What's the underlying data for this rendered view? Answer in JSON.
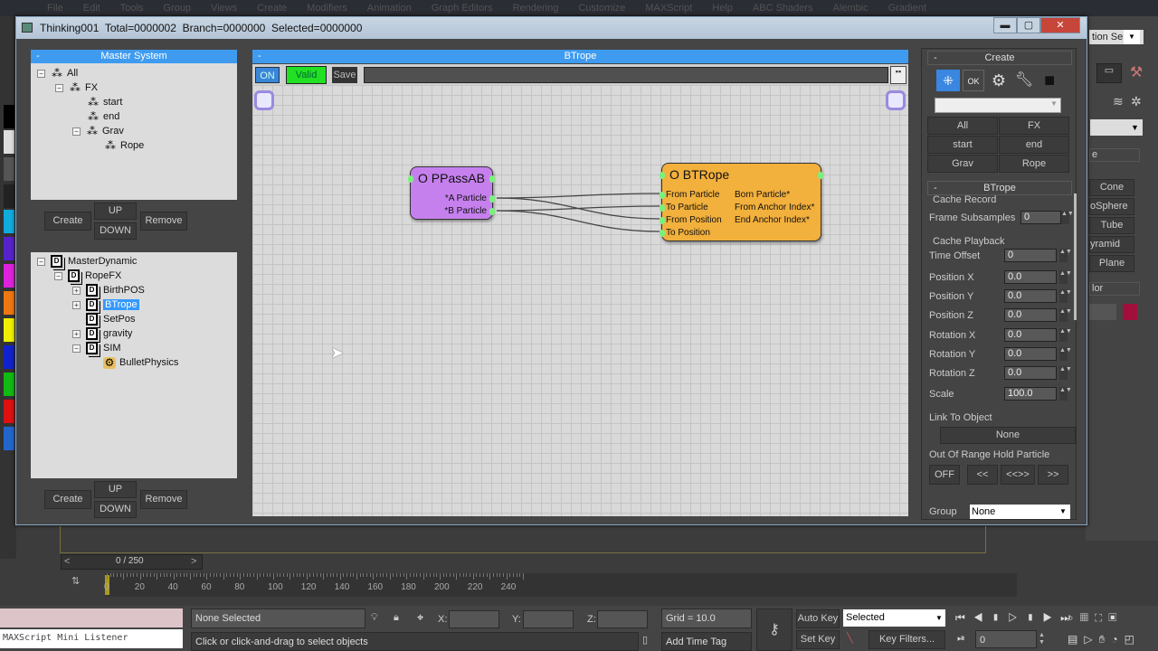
{
  "menubar": [
    "File",
    "Edit",
    "Tools",
    "Group",
    "Views",
    "Create",
    "Modifiers",
    "Animation",
    "Graph Editors",
    "Rendering",
    "Customize",
    "MAXScript",
    "Help",
    "ABC Shaders",
    "Alembic",
    "Gradient"
  ],
  "window": {
    "title": "Thinking001  Total=0000002  Branch=0000000  Selected=0000000"
  },
  "master_system": {
    "title": "Master System",
    "collapse": "-",
    "tree": [
      {
        "label": "All",
        "expanded": true,
        "depth": 0
      },
      {
        "label": "FX",
        "expanded": true,
        "depth": 1
      },
      {
        "label": "start",
        "depth": 2
      },
      {
        "label": "end",
        "depth": 2
      },
      {
        "label": "Grav",
        "expanded": true,
        "depth": 2
      },
      {
        "label": "Rope",
        "depth": 3
      }
    ],
    "buttons": {
      "create": "Create",
      "up": "UP",
      "down": "DOWN",
      "remove": "Remove"
    }
  },
  "dynamic_tree": {
    "tree": [
      {
        "label": "MasterDynamic",
        "depth": 0,
        "toggle": "−"
      },
      {
        "label": "RopeFX",
        "depth": 1,
        "toggle": "−"
      },
      {
        "label": "BirthPOS",
        "depth": 2,
        "toggle": "+"
      },
      {
        "label": "BTrope",
        "depth": 2,
        "toggle": "+",
        "selected": true
      },
      {
        "label": "SetPos",
        "depth": 2
      },
      {
        "label": "gravity",
        "depth": 2,
        "toggle": "+"
      },
      {
        "label": "SIM",
        "depth": 2,
        "toggle": "−"
      },
      {
        "label": "BulletPhysics",
        "depth": 3
      }
    ],
    "buttons": {
      "create": "Create",
      "up": "UP",
      "down": "DOWN",
      "remove": "Remove"
    }
  },
  "graph": {
    "title": "BTrope",
    "collapse": "-",
    "toolbar": {
      "on": "ON",
      "valid": "Valid",
      "save": "Save"
    },
    "nodes": {
      "ppass": {
        "title": "O PPassAB",
        "color": "#c680ee",
        "outputs": [
          "*A Particle",
          "*B Particle"
        ]
      },
      "btrope": {
        "title": "O BTRope",
        "color": "#f2b03c",
        "inputs": [
          "From Particle",
          "To Particle",
          "From Position",
          "To Position"
        ],
        "outputs": [
          "Born Particle*",
          "From Anchor Index*",
          "End Anchor Index*"
        ]
      }
    },
    "connections": [
      {
        "from": "*A Particle",
        "to": "From Particle"
      },
      {
        "from": "*A Particle",
        "to": "From Position"
      },
      {
        "from": "*B Particle",
        "to": "To Particle"
      },
      {
        "from": "*B Particle",
        "to": "To Position"
      }
    ]
  },
  "right_panel": {
    "create_title": "Create",
    "collapse": "-",
    "icons": [
      "particle-add-icon",
      "ok-icon",
      "gear-icon",
      "wrench-icon",
      "cube-icon"
    ],
    "dropdown_value": "",
    "group_buttons": [
      "All",
      "FX",
      "start",
      "end",
      "Grav",
      "Rope"
    ],
    "btrope_title": "BTrope",
    "cache_record": {
      "label": "Cache Record",
      "frame_subsamples_label": "Frame Subsamples",
      "frame_subsamples": "0"
    },
    "cache_playback": {
      "label": "Cache Playback",
      "fields": [
        {
          "label": "Time Offset",
          "value": "0"
        },
        {
          "label": "Position X",
          "value": "0.0"
        },
        {
          "label": "Position Y",
          "value": "0.0"
        },
        {
          "label": "Position Z",
          "value": "0.0"
        },
        {
          "label": "Rotation X",
          "value": "0.0"
        },
        {
          "label": "Rotation Y",
          "value": "0.0"
        },
        {
          "label": "Rotation Z",
          "value": "0.0"
        },
        {
          "label": "Scale",
          "value": "100.0"
        }
      ]
    },
    "link_label": "Link To Object",
    "link_value": "None",
    "range_label": "Out Of Range Hold Particle",
    "range_buttons": [
      "OFF",
      "<<",
      "<<>>",
      ">>"
    ],
    "group_label": "Group",
    "group_value": "None"
  },
  "command_panel": {
    "selection_set": "tion Se",
    "items": [
      "Cone",
      "oSphere",
      "Tube",
      "yramid",
      "Plane"
    ],
    "section": "e",
    "color_label": "lor",
    "color": "#a0103a"
  },
  "timeline": {
    "frame": "0 / 250",
    "ticks": [
      "0",
      "20",
      "40",
      "60",
      "80",
      "100",
      "120",
      "140",
      "160",
      "180",
      "200",
      "220",
      "240"
    ]
  },
  "status": {
    "listener": "MAXScript Mini Listener",
    "selection": "None Selected",
    "prompt": "Click or click-and-drag to select objects",
    "x_label": "X:",
    "y_label": "Y:",
    "z_label": "Z:",
    "grid": "Grid = 10.0",
    "add_time_tag": "Add Time Tag",
    "auto_key": "Auto Key",
    "set_key": "Set Key",
    "key_mode": "Selected",
    "key_filters": "Key Filters...",
    "current_frame": "0"
  }
}
